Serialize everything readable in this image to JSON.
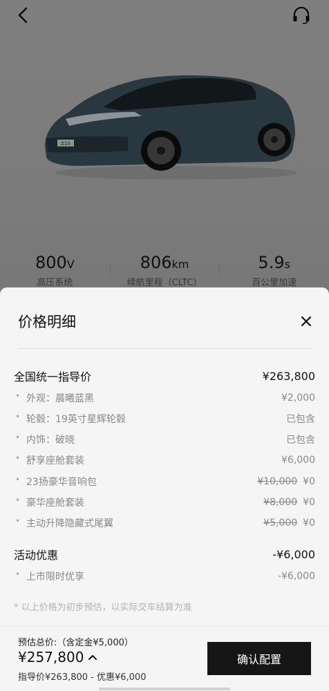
{
  "header": {
    "back_icon": "chevron-left-icon",
    "support_icon": "headset-icon"
  },
  "car": {
    "badge": "Z10",
    "paint_color": "#3f5563"
  },
  "specs": [
    {
      "value": "800",
      "unit": "V",
      "label": "高压系统"
    },
    {
      "value": "806",
      "unit": "km",
      "label": "续航里程（CLTC）"
    },
    {
      "value": "5.9",
      "unit": "s",
      "label": "百公里加速"
    }
  ],
  "sheet": {
    "title": "价格明细",
    "close_icon": "close-icon",
    "guide_price": {
      "label": "全国统一指导价",
      "value": "¥263,800"
    },
    "items": [
      {
        "label": "外观：晨曦蓝黑",
        "value": "¥2,000"
      },
      {
        "label": "轮毂：19英寸星辉轮毂",
        "value": "已包含"
      },
      {
        "label": "内饰：破晓",
        "value": "已包含"
      },
      {
        "label": "舒享座舱套装",
        "value": "¥6,000"
      },
      {
        "label": "23扬豪华音响包",
        "original": "¥10,000",
        "value": "¥0"
      },
      {
        "label": "豪华座舱套装",
        "original": "¥8,000",
        "value": "¥0"
      },
      {
        "label": "主动升降隐藏式尾翼",
        "original": "¥5,000",
        "value": "¥0"
      }
    ],
    "promotion": {
      "label": "活动优惠",
      "value": "-¥6,000"
    },
    "promotion_items": [
      {
        "label": "上市限时优享",
        "value": "-¥6,000"
      }
    ],
    "note": "* 以上价格为初步预估，以实际交车结算为准"
  },
  "footer": {
    "estimate_label": "预估总价:（含定金¥5,000）",
    "estimate_total": "¥257,800",
    "expand_icon": "chevron-up-icon",
    "breakdown": "指导价¥263,800 - 优惠¥6,000",
    "confirm_label": "确认配置"
  }
}
